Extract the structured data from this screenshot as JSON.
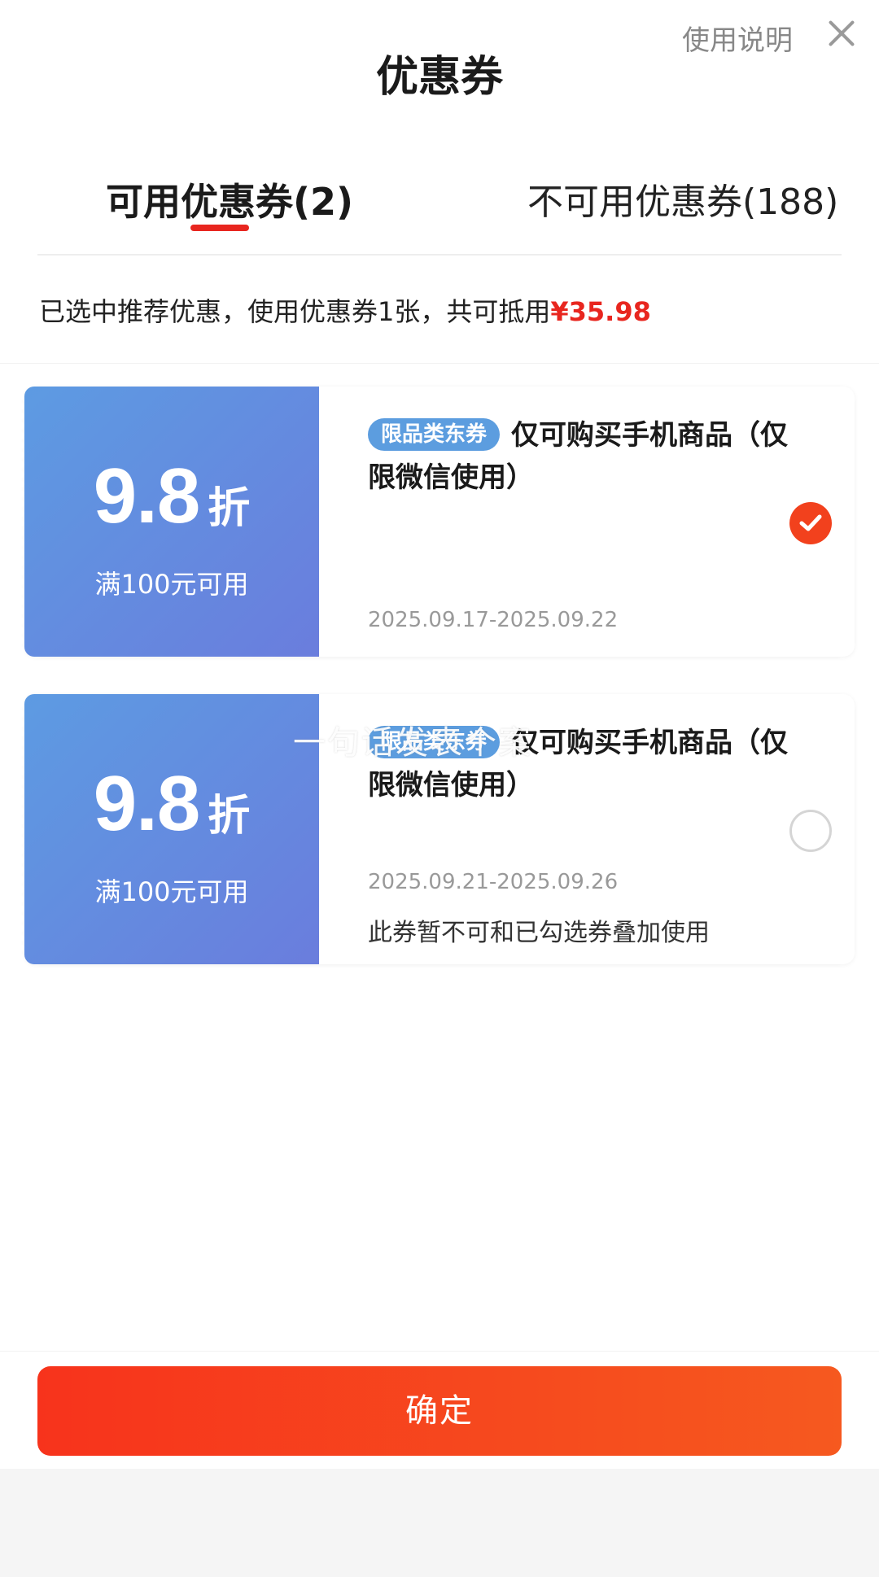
{
  "header": {
    "title": "优惠券",
    "help_label": "使用说明"
  },
  "tabs": [
    {
      "label": "可用优惠券(2)",
      "active": true
    },
    {
      "label": "不可用优惠券(188)",
      "active": false
    }
  ],
  "summary": {
    "text": "已选中推荐优惠，使用优惠券1张，共可抵用",
    "amount": "¥35.98"
  },
  "coupons": [
    {
      "discount": "9.8",
      "unit": "折",
      "threshold": "满100元可用",
      "tag": "限品类东券",
      "description": "仅可购买手机商品（仅限微信使用）",
      "validity": "2025.09.17-2025.09.22",
      "note": "",
      "selected": true
    },
    {
      "discount": "9.8",
      "unit": "折",
      "threshold": "满100元可用",
      "tag": "限品类东券",
      "description": "仅可购买手机商品（仅限微信使用）",
      "validity": "2025.09.21-2025.09.26",
      "note": "此券暂不可和已勾选券叠加使用",
      "selected": false
    }
  ],
  "overlay_text": "一句话发表个案",
  "footer": {
    "confirm_label": "确定"
  },
  "colors": {
    "accent": "#e8261f",
    "coupon_left_start": "#5d9be2",
    "coupon_left_end": "#6a7ddd",
    "confirm_start": "#f7331c",
    "confirm_end": "#f6591f"
  }
}
